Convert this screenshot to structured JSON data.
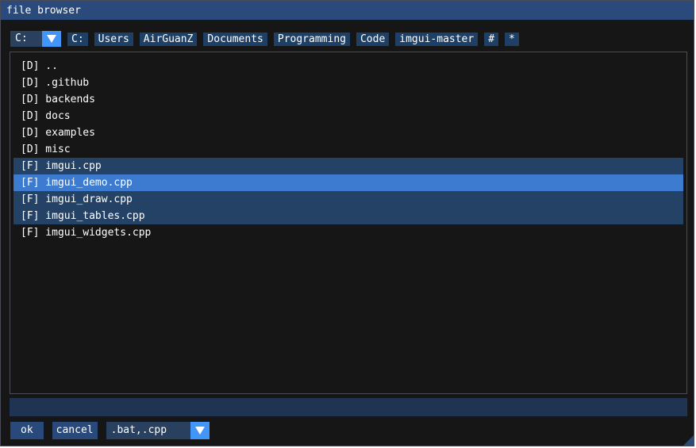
{
  "window": {
    "title": "file browser"
  },
  "pathbar": {
    "drive": "C:",
    "crumbs": [
      "C:",
      "Users",
      "AirGuanZ",
      "Documents",
      "Programming",
      "Code",
      "imgui-master",
      "#",
      "*"
    ]
  },
  "files": [
    {
      "label": "[D] .."
    },
    {
      "label": "[D] .github"
    },
    {
      "label": "[D] backends"
    },
    {
      "label": "[D] docs"
    },
    {
      "label": "[D] examples"
    },
    {
      "label": "[D] misc"
    },
    {
      "label": "[F] imgui.cpp",
      "selected": true
    },
    {
      "label": "[F] imgui_demo.cpp",
      "selected": true,
      "focused": true
    },
    {
      "label": "[F] imgui_draw.cpp",
      "selected": true
    },
    {
      "label": "[F] imgui_tables.cpp",
      "selected": true
    },
    {
      "label": "[F] imgui_widgets.cpp"
    }
  ],
  "filename_input": {
    "value": ""
  },
  "bottom": {
    "ok_label": "ok",
    "cancel_label": "cancel",
    "filter": ".bat,.cpp"
  },
  "colors": {
    "accent": "#4296fa",
    "title_bg": "#294a7a",
    "selected_row": "#244266",
    "focused_row": "#3c7bd0"
  }
}
